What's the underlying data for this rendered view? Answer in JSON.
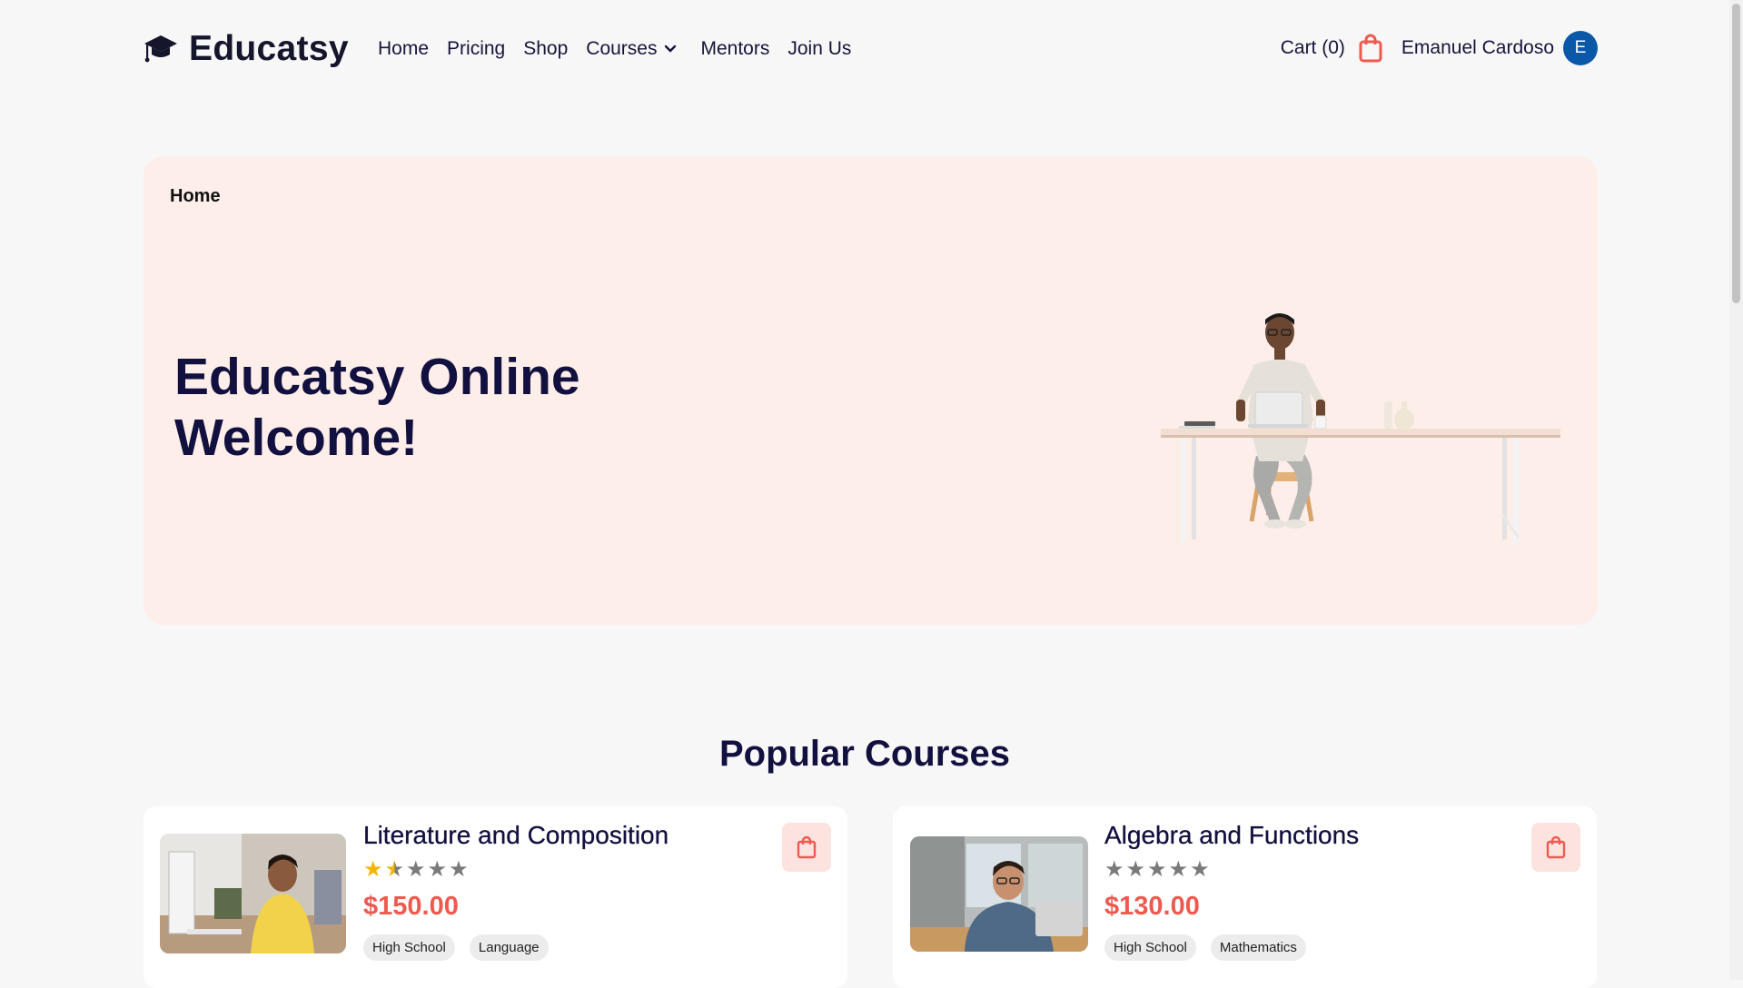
{
  "brand": {
    "name": "Educatsy",
    "logo_icon": "graduation-cap-icon"
  },
  "nav": {
    "items": [
      {
        "label": "Home"
      },
      {
        "label": "Pricing"
      },
      {
        "label": "Shop"
      },
      {
        "label": "Courses",
        "has_dropdown": true
      },
      {
        "label": "Mentors"
      },
      {
        "label": "Join Us"
      }
    ]
  },
  "account": {
    "cart_label": "Cart (0)",
    "cart_icon": "shopping-bag-icon",
    "user_name": "Emanuel Cardoso",
    "avatar_initial": "E"
  },
  "hero": {
    "breadcrumb": "Home",
    "title_line1": "Educatsy Online",
    "title_line2": "Welcome!",
    "image": "person-at-desk-illustration"
  },
  "popular": {
    "title": "Popular Courses",
    "courses": [
      {
        "title": "Literature and Composition",
        "rating": 1.5,
        "rating_max": 5,
        "price": "$150.00",
        "tags": [
          "High School",
          "Language"
        ]
      },
      {
        "title": "Algebra and Functions",
        "rating": 0,
        "rating_max": 5,
        "price": "$130.00",
        "tags": [
          "High School",
          "Mathematics"
        ]
      }
    ]
  },
  "colors": {
    "accent": "#ee5a4f",
    "hero_bg": "#fdeeea",
    "avatar_bg": "#0b57a8",
    "heading": "#12103f",
    "star_filled": "#f6b400"
  }
}
